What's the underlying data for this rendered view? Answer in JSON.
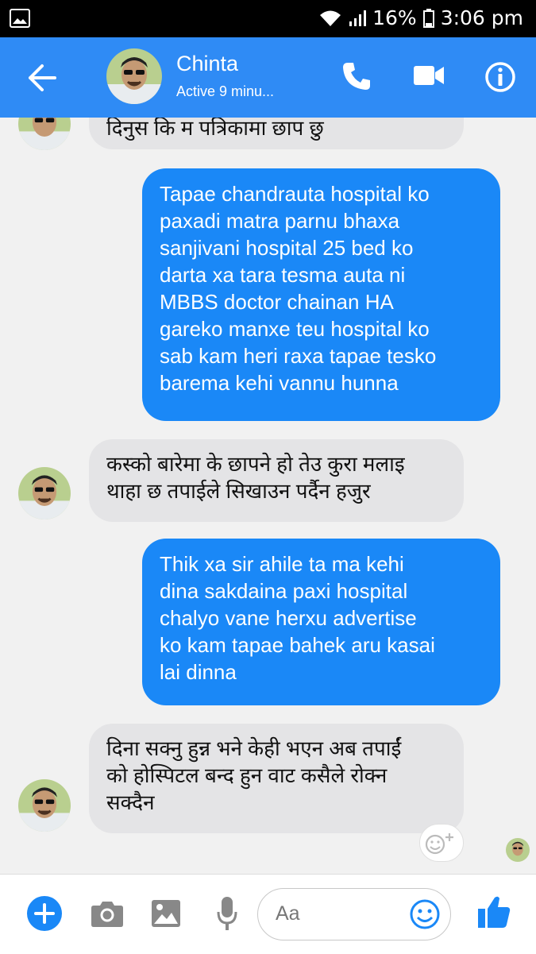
{
  "status_bar": {
    "battery": "16%",
    "time": "3:06 pm",
    "icons": [
      "image-icon",
      "wifi-icon",
      "signal-icon",
      "battery-icon"
    ]
  },
  "header": {
    "contact_name": "Chinta",
    "status": "Active 9 minu...",
    "accent": "#2f8bf5"
  },
  "messages": [
    {
      "from": "contact",
      "text": "दिनुस कि म पत्रिकामा छाप छु"
    },
    {
      "from": "me",
      "lines": [
        "Tapae chandrauta hospital ko",
        "paxadi matra parnu bhaxa",
        "sanjivani hospital 25 bed ko",
        "darta xa tara tesma auta ni",
        "MBBS doctor chainan HA",
        "gareko manxe teu hospital ko",
        "sab kam heri raxa tapae tesko",
        "barema kehi vannu hunna"
      ]
    },
    {
      "from": "contact",
      "lines": [
        "कस्को बारेमा के छापने हो तेउ कुरा मलाइ",
        "थाहा छ तपाईले सिखाउन पर्दैन हजुर"
      ]
    },
    {
      "from": "me",
      "lines": [
        "Thik xa sir ahile ta ma kehi",
        "dina sakdaina paxi hospital",
        "chalyo vane herxu advertise",
        "ko kam tapae bahek aru kasai",
        "lai dinna"
      ]
    },
    {
      "from": "contact",
      "lines": [
        "दिना सक्नु हुन्न भने केही भएन अब तपाईं",
        "को होस्पिटल बन्द हुन वाट कसैले रोक्न",
        "सक्दैन"
      ]
    }
  ],
  "composer": {
    "placeholder": "Aa"
  },
  "colors": {
    "outgoing_bubble": "#1a88f7",
    "incoming_bubble": "#e4e4e6",
    "background": "#f1f1f1"
  }
}
